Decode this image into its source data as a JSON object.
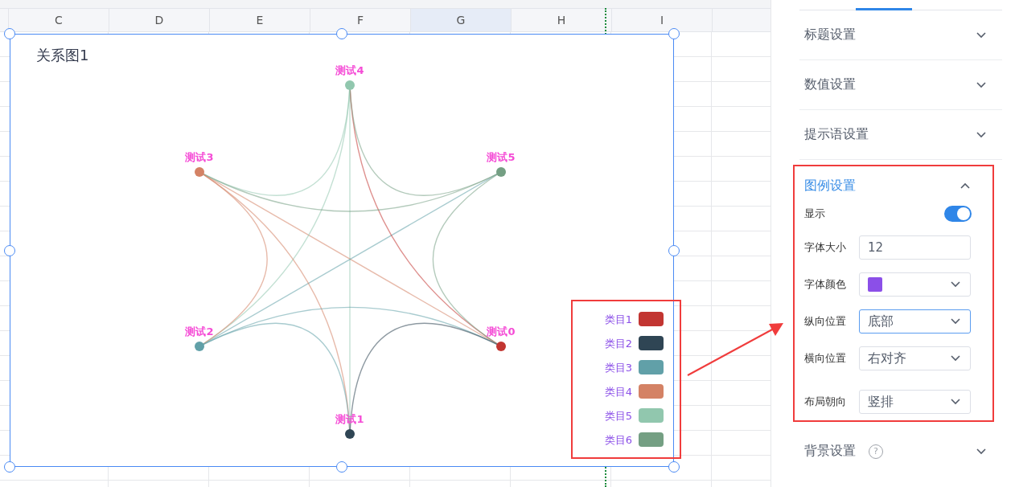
{
  "sheet": {
    "columns": [
      {
        "label": "C",
        "selected": false
      },
      {
        "label": "D",
        "selected": false
      },
      {
        "label": "E",
        "selected": false
      },
      {
        "label": "F",
        "selected": false
      },
      {
        "label": "G",
        "selected": true
      },
      {
        "label": "H",
        "selected": false
      },
      {
        "label": "I",
        "selected": false
      }
    ],
    "page_break": true
  },
  "chart": {
    "title": "关系图1",
    "selected": true,
    "nodes": [
      {
        "name": "测试4",
        "color": "#91c7ae"
      },
      {
        "name": "测试3",
        "color": "#d48265"
      },
      {
        "name": "测试5",
        "color": "#749f83"
      },
      {
        "name": "测试2",
        "color": "#61a0a8"
      },
      {
        "name": "测试0",
        "color": "#c23531"
      },
      {
        "name": "测试1",
        "color": "#2f4554"
      }
    ],
    "legend": {
      "highlighted": true,
      "items": [
        {
          "label": "类目1",
          "color": "#c23531"
        },
        {
          "label": "类目2",
          "color": "#2f4554"
        },
        {
          "label": "类目3",
          "color": "#61a0a8"
        },
        {
          "label": "类目4",
          "color": "#d48265"
        },
        {
          "label": "类目5",
          "color": "#91c7ae"
        },
        {
          "label": "类目6",
          "color": "#749f83"
        }
      ]
    }
  },
  "callout_arrow": true,
  "panel": {
    "sections": [
      {
        "title": "标题设置",
        "expanded": false
      },
      {
        "title": "数值设置",
        "expanded": false
      },
      {
        "title": "提示语设置",
        "expanded": false
      },
      {
        "title": "图例设置",
        "expanded": true,
        "highlighted": true,
        "fields": [
          {
            "kind": "toggle",
            "label": "显示",
            "on": true
          },
          {
            "kind": "input",
            "label": "字体大小",
            "value": "12"
          },
          {
            "kind": "color",
            "label": "字体颜色",
            "color": "#8b4fe8"
          },
          {
            "kind": "select",
            "label": "纵向位置",
            "value": "底部",
            "focused": true
          },
          {
            "kind": "select",
            "label": "横向位置",
            "value": "右对齐",
            "focused": false
          },
          {
            "kind": "select",
            "label": "布局朝向",
            "value": "竖排",
            "focused": false
          }
        ]
      },
      {
        "title": "背景设置",
        "expanded": false,
        "help": "?"
      }
    ]
  }
}
